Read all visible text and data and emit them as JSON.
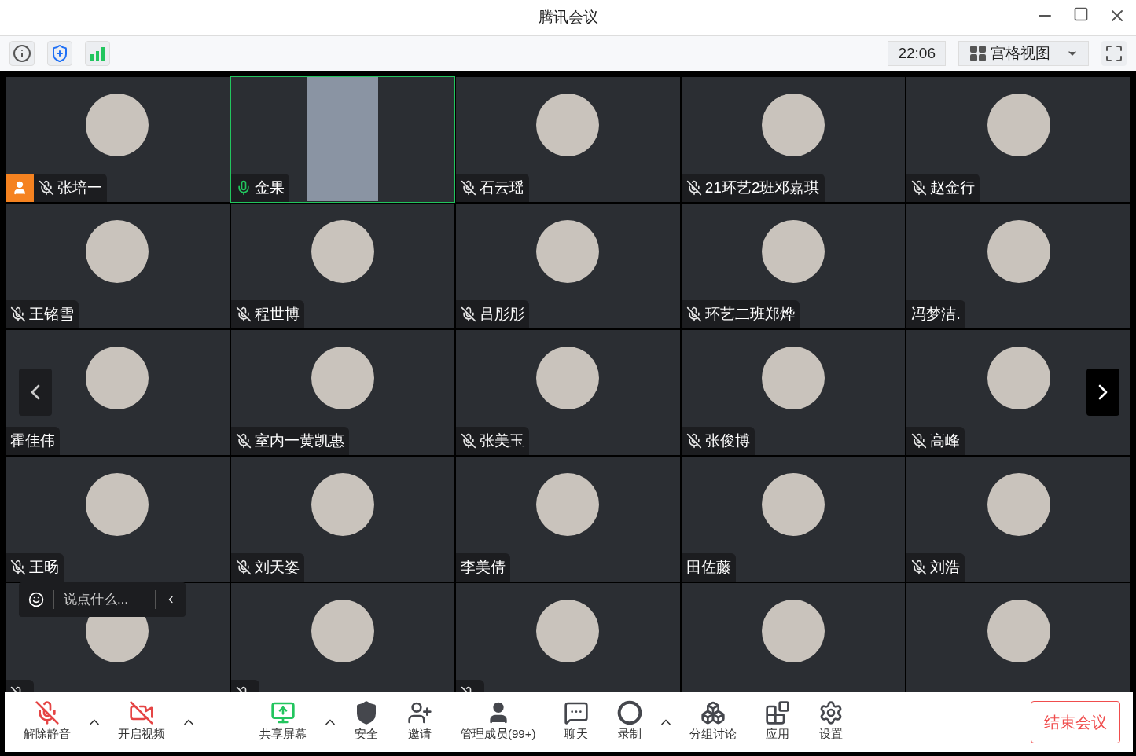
{
  "window": {
    "title": "腾讯会议"
  },
  "top_bar": {
    "time": "22:06",
    "view_menu": "宫格视图"
  },
  "tiles": [
    {
      "name": "张培一",
      "muted": true,
      "mic_on": false,
      "host": true,
      "video": false,
      "speaking": false
    },
    {
      "name": "金果",
      "muted": false,
      "mic_on": true,
      "host": false,
      "video": true,
      "speaking": true
    },
    {
      "name": "石云瑶",
      "muted": true,
      "mic_on": false,
      "host": false,
      "video": false,
      "speaking": false
    },
    {
      "name": "21环艺2班邓嘉琪",
      "muted": true,
      "mic_on": false,
      "host": false,
      "video": false,
      "speaking": false
    },
    {
      "name": "赵金行",
      "muted": true,
      "mic_on": false,
      "host": false,
      "video": false,
      "speaking": false
    },
    {
      "name": "王铭雪",
      "muted": true,
      "mic_on": false,
      "host": false,
      "video": false,
      "speaking": false
    },
    {
      "name": "程世博",
      "muted": true,
      "mic_on": false,
      "host": false,
      "video": false,
      "speaking": false
    },
    {
      "name": "吕彤彤",
      "muted": true,
      "mic_on": false,
      "host": false,
      "video": false,
      "speaking": false
    },
    {
      "name": "环艺二班郑烨",
      "muted": true,
      "mic_on": false,
      "host": false,
      "video": false,
      "speaking": false
    },
    {
      "name": "冯梦洁.",
      "muted": false,
      "mic_on": false,
      "host": false,
      "video": false,
      "speaking": false
    },
    {
      "name": "霍佳伟",
      "muted": false,
      "mic_on": false,
      "host": false,
      "video": false,
      "speaking": false
    },
    {
      "name": "室内一黄凯惠",
      "muted": true,
      "mic_on": false,
      "host": false,
      "video": false,
      "speaking": false
    },
    {
      "name": "张美玉",
      "muted": true,
      "mic_on": false,
      "host": false,
      "video": false,
      "speaking": false
    },
    {
      "name": "张俊博",
      "muted": true,
      "mic_on": false,
      "host": false,
      "video": false,
      "speaking": false
    },
    {
      "name": "高峰",
      "muted": true,
      "mic_on": false,
      "host": false,
      "video": false,
      "speaking": false
    },
    {
      "name": "王旸",
      "muted": true,
      "mic_on": false,
      "host": false,
      "video": false,
      "speaking": false
    },
    {
      "name": "刘天姿",
      "muted": true,
      "mic_on": false,
      "host": false,
      "video": false,
      "speaking": false
    },
    {
      "name": "李美倩",
      "muted": false,
      "mic_on": false,
      "host": false,
      "video": false,
      "speaking": false
    },
    {
      "name": "田佐藤",
      "muted": false,
      "mic_on": false,
      "host": false,
      "video": false,
      "speaking": false
    },
    {
      "name": "刘浩",
      "muted": true,
      "mic_on": false,
      "host": false,
      "video": false,
      "speaking": false
    },
    {
      "muted": true,
      "mic_on": false,
      "host": false,
      "video": false,
      "speaking": false
    },
    {
      "muted": true,
      "mic_on": false,
      "host": false,
      "video": false,
      "speaking": false
    },
    {
      "muted": true,
      "mic_on": false,
      "host": false,
      "video": false,
      "speaking": false
    },
    {
      "muted": false,
      "mic_on": false,
      "host": false,
      "video": false,
      "speaking": false
    },
    {
      "muted": false,
      "mic_on": false,
      "host": false,
      "video": false,
      "speaking": false
    }
  ],
  "chat_input": {
    "placeholder": "说点什么..."
  },
  "toolbar": [
    {
      "kind": "mic",
      "label": "解除静音",
      "caret": true
    },
    {
      "kind": "video",
      "label": "开启视频",
      "caret": true
    },
    {
      "kind": "share",
      "label": "共享屏幕",
      "caret": true
    },
    {
      "kind": "security",
      "label": "安全",
      "caret": false
    },
    {
      "kind": "invite",
      "label": "邀请",
      "caret": false
    },
    {
      "kind": "members",
      "label": "管理成员(99+)",
      "caret": false
    },
    {
      "kind": "chat",
      "label": "聊天",
      "caret": false
    },
    {
      "kind": "record",
      "label": "录制",
      "caret": true
    },
    {
      "kind": "breakout",
      "label": "分组讨论",
      "caret": false
    },
    {
      "kind": "apps",
      "label": "应用",
      "caret": false
    },
    {
      "kind": "settings",
      "label": "设置",
      "caret": false
    }
  ],
  "end_button": "结束会议"
}
